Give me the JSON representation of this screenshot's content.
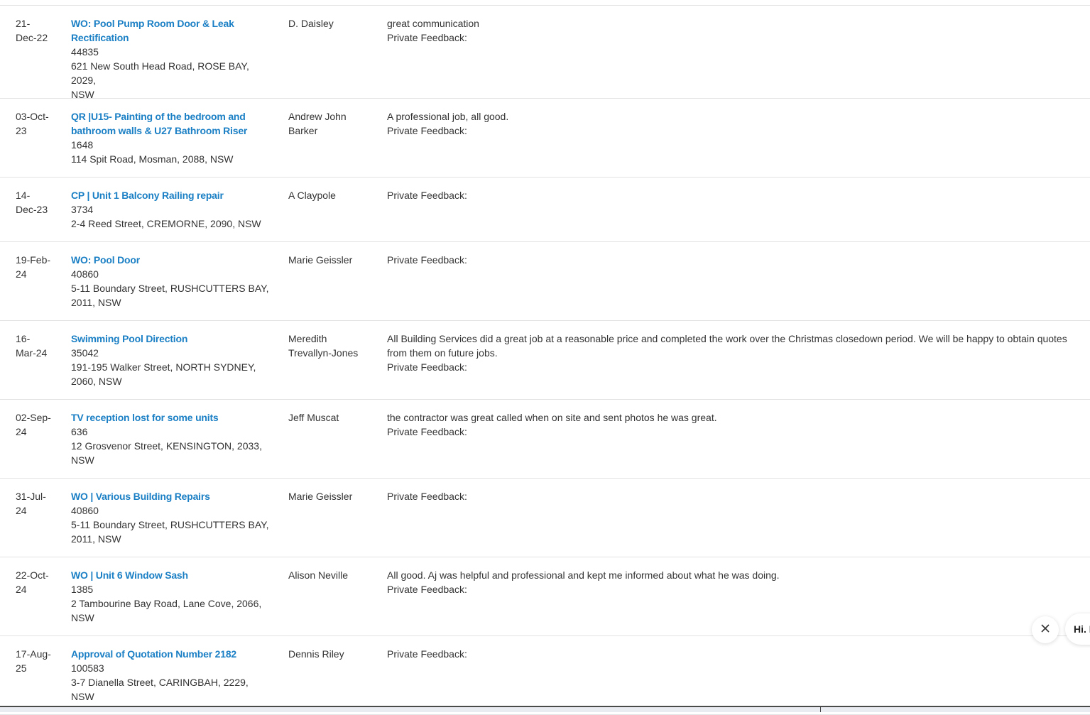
{
  "rows": [
    {
      "date_lines": [
        "21-",
        "Dec-22"
      ],
      "title_lines": [
        "WO: Pool Pump Room Door & Leak",
        "Rectification"
      ],
      "number": "44835",
      "address_lines": [
        "621 New South Head Road, ROSE BAY, 2029,",
        "NSW"
      ],
      "name_lines": [
        "D. Daisley"
      ],
      "feedback_lines": [
        "great communication"
      ],
      "private_label": "Private Feedback:"
    },
    {
      "date_lines": [
        "03-Oct-",
        "23"
      ],
      "title_lines": [
        "QR |U15- Painting of the bedroom and",
        "bathroom walls & U27 Bathroom Riser"
      ],
      "number": "1648",
      "address_lines": [
        "114 Spit Road, Mosman, 2088, NSW"
      ],
      "name_lines": [
        "Andrew John",
        "Barker"
      ],
      "feedback_lines": [
        "A professional job, all good."
      ],
      "private_label": "Private Feedback:"
    },
    {
      "date_lines": [
        "14-",
        "Dec-23"
      ],
      "title_lines": [
        "CP | Unit 1 Balcony Railing repair"
      ],
      "number": "3734",
      "address_lines": [
        "2-4 Reed Street, CREMORNE, 2090, NSW"
      ],
      "name_lines": [
        "A Claypole"
      ],
      "feedback_lines": [],
      "private_label": "Private Feedback:"
    },
    {
      "date_lines": [
        "19-Feb-",
        "24"
      ],
      "title_lines": [
        "WO: Pool Door"
      ],
      "number": "40860",
      "address_lines": [
        "5-11 Boundary Street, RUSHCUTTERS BAY,",
        "2011, NSW"
      ],
      "name_lines": [
        "Marie Geissler"
      ],
      "feedback_lines": [],
      "private_label": "Private Feedback:"
    },
    {
      "date_lines": [
        "16-",
        "Mar-24"
      ],
      "title_lines": [
        "Swimming Pool Direction"
      ],
      "number": "35042",
      "address_lines": [
        "191-195 Walker Street, NORTH SYDNEY,",
        "2060, NSW"
      ],
      "name_lines": [
        "Meredith",
        "Trevallyn-Jones"
      ],
      "feedback_lines": [
        "All Building Services did a great job at a reasonable price and completed the work over the Christmas closedown period. We will be happy to obtain quotes",
        "from them on future jobs."
      ],
      "private_label": "Private Feedback:"
    },
    {
      "date_lines": [
        "02-Sep-",
        "24"
      ],
      "title_lines": [
        "TV reception lost for some units"
      ],
      "number": "636",
      "address_lines": [
        "12 Grosvenor Street, KENSINGTON, 2033,",
        "NSW"
      ],
      "name_lines": [
        "Jeff Muscat"
      ],
      "feedback_lines": [
        "the contractor was great called when on site and sent photos he was great."
      ],
      "private_label": "Private Feedback:"
    },
    {
      "date_lines": [
        "31-Jul-",
        "24"
      ],
      "title_lines": [
        "WO | Various Building Repairs"
      ],
      "number": "40860",
      "address_lines": [
        "5-11 Boundary Street, RUSHCUTTERS BAY,",
        "2011, NSW"
      ],
      "name_lines": [
        "Marie Geissler"
      ],
      "feedback_lines": [],
      "private_label": "Private Feedback:"
    },
    {
      "date_lines": [
        "22-Oct-",
        "24"
      ],
      "title_lines": [
        "WO | Unit 6 Window Sash"
      ],
      "number": "1385",
      "address_lines": [
        "2 Tambourine Bay Road, Lane Cove, 2066,",
        "NSW"
      ],
      "name_lines": [
        "Alison Neville"
      ],
      "feedback_lines": [
        "All good. Aj was helpful and professional and kept me informed about what he was doing."
      ],
      "private_label": "Private Feedback:"
    },
    {
      "date_lines": [
        "17-Aug-",
        "25"
      ],
      "title_lines": [
        "Approval of Quotation Number 2182"
      ],
      "number": "100583",
      "address_lines": [
        "3-7 Dianella Street, CARINGBAH, 2229,",
        "NSW"
      ],
      "name_lines": [
        "Dennis Riley"
      ],
      "feedback_lines": [],
      "private_label": "Private Feedback:"
    }
  ],
  "chat_widget": {
    "greeting": "Hi. I",
    "close_icon": "close-icon"
  }
}
